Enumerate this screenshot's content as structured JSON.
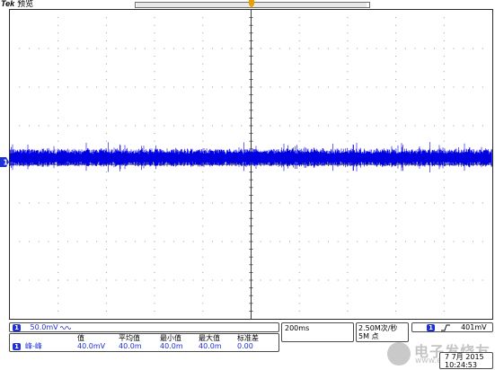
{
  "header": {
    "brand": "Tek",
    "mode": "预览"
  },
  "channel": {
    "number": "1",
    "scale": "50.0mV",
    "bw_icon": "bandwidth-limit-icon"
  },
  "measurements": {
    "channel_label": "1",
    "row_label": "峰-峰",
    "headers": [
      "值",
      "平均值",
      "最小值",
      "最大值",
      "标准差"
    ],
    "values": [
      "40.0mV",
      "40.0m",
      "40.0m",
      "40.0m",
      "0.00"
    ]
  },
  "timebase": {
    "horizontal": "200ms",
    "sample_rate": "2.50M次/秒",
    "record_length": "5M 点"
  },
  "trigger": {
    "source": "1",
    "slope_icon": "rising-edge-icon",
    "level": "401mV"
  },
  "datetime": {
    "date": "7 7月 2015",
    "time": "10:24:53"
  },
  "watermark": {
    "text": "电子发烧友",
    "url": "www.elecfans.com"
  },
  "colors": {
    "trace": "#0000e0",
    "channel": "#1c2fd8",
    "trigger_marker": "#e8a000"
  }
}
